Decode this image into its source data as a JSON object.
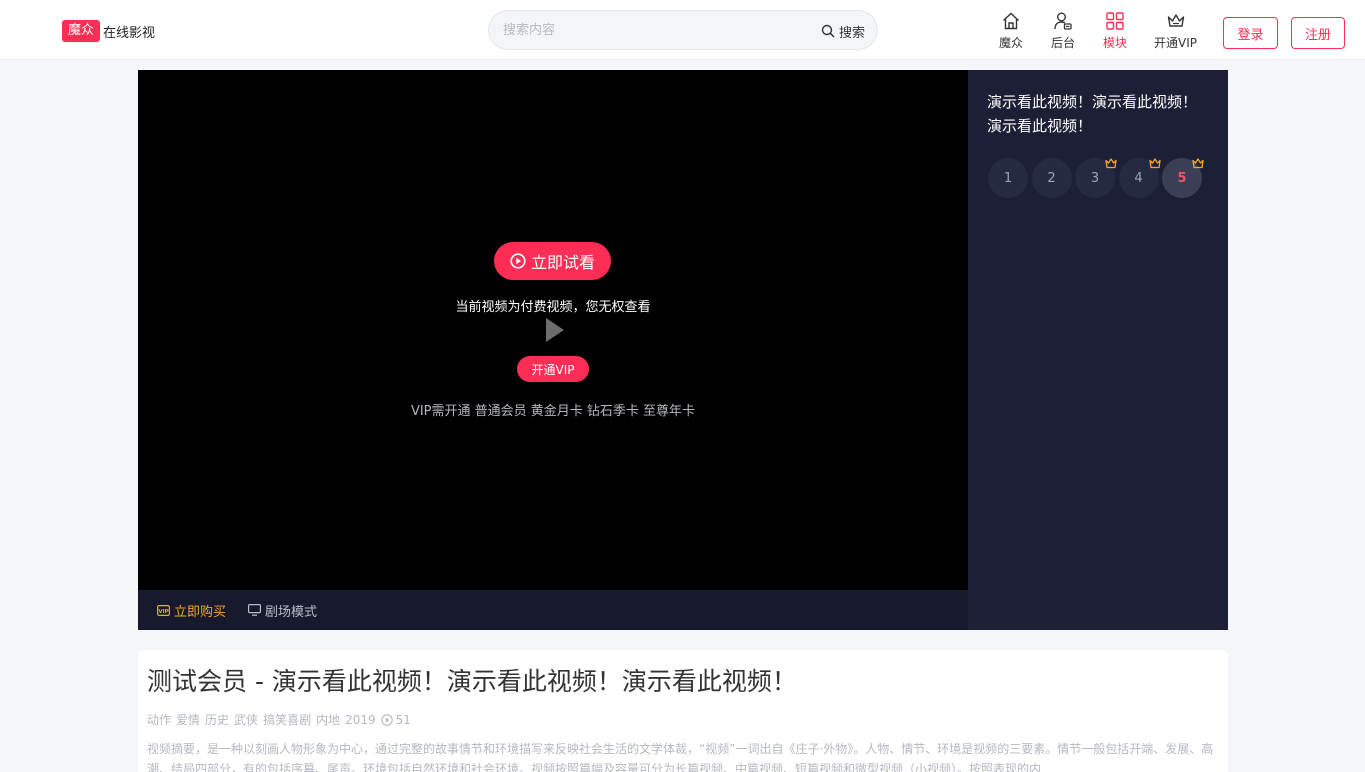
{
  "header": {
    "logo_badge": "魔众",
    "logo_text": "在线影视",
    "search_placeholder": "搜索内容",
    "search_button": "搜索",
    "nav": [
      {
        "label": "魔众",
        "icon": "home-icon"
      },
      {
        "label": "后台",
        "icon": "user-admin-icon"
      },
      {
        "label": "模块",
        "icon": "grid-icon"
      },
      {
        "label": "开通VIP",
        "icon": "crown-icon"
      }
    ],
    "login": "登录",
    "register": "注册"
  },
  "player": {
    "trial_button": "立即试看",
    "no_access": "当前视频为付费视频，您无权查看",
    "vip_button": "开通VIP",
    "vip_note": "VIP需开通 普通会员 黄金月卡 钻石季卡 至尊年卡",
    "buy": "立即购买",
    "theater": "剧场模式"
  },
  "side": {
    "title": "演示看此视频！演示看此视频！演示看此视频！",
    "episodes": [
      "1",
      "2",
      "3",
      "4",
      "5"
    ],
    "vip_episodes": [
      "3",
      "4",
      "5"
    ],
    "active_episode": "5"
  },
  "info": {
    "title": "测试会员 - 演示看此视频！演示看此视频！演示看此视频！",
    "tags": [
      "动作",
      "爱情",
      "历史",
      "武侠",
      "搞笑喜剧"
    ],
    "region": "内地",
    "year": "2019",
    "views": "51",
    "description": "视频摘要，是一种以刻画人物形象为中心，通过完整的故事情节和环境描写来反映社会生活的文学体裁，“视频”一词出自《庄子·外物》。人物、情节、环境是视频的三要素。情节一般包括开端、发展、高潮、结局四部分，有的包括序幕、尾声。环境包括自然环境和社会环境。视频按照篇幅及容量可分为长篇视频、中篇视频、短篇视频和微型视频（小视频）。按照表现的内"
  },
  "colors": {
    "accent": "#fd2d55",
    "gold": "#f5a623",
    "side_bg": "#1c1f36"
  }
}
